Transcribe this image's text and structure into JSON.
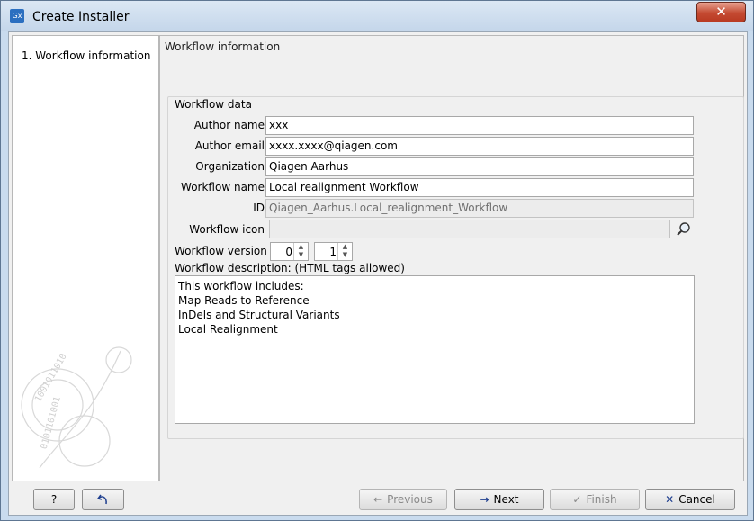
{
  "window": {
    "title": "Create Installer",
    "app_icon_text": "Gx",
    "close_glyph": "✕"
  },
  "steps": [
    {
      "label": "1.  Workflow information"
    }
  ],
  "panel": {
    "title": "Workflow information",
    "group_label": "Workflow data",
    "fields": {
      "author_name": {
        "label": "Author name",
        "value": "xxx"
      },
      "author_email": {
        "label": "Author email",
        "value": "xxxx.xxxx@qiagen.com"
      },
      "organization": {
        "label": "Organization",
        "value": "Qiagen Aarhus"
      },
      "workflow_name": {
        "label": "Workflow name",
        "value": "Local realignment Workflow"
      },
      "id": {
        "label": "ID",
        "value": "Qiagen_Aarhus.Local_realignment_Workflow"
      },
      "workflow_icon": {
        "label": "Workflow icon",
        "value": "",
        "browse_icon": "search-icon"
      }
    },
    "version": {
      "label": "Workflow version",
      "major": "0",
      "minor": "1"
    },
    "description": {
      "label": "Workflow description: (HTML tags allowed)",
      "lines": [
        "This workflow includes:",
        "Map Reads to Reference",
        "InDels and Structural Variants",
        "Local Realignment"
      ]
    }
  },
  "buttons": {
    "help": "?",
    "reset_icon": "undo-icon",
    "previous": "Previous",
    "next": "Next",
    "finish": "Finish",
    "cancel": "Cancel"
  },
  "colors": {
    "window_frame": "#c9dbee",
    "close_button": "#c44a32",
    "next_arrow": "#1f3f8f",
    "cancel_x": "#1f3f8f"
  }
}
